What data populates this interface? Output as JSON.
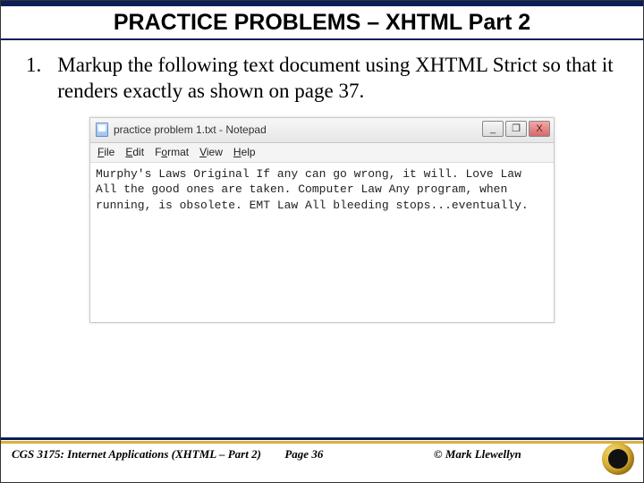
{
  "title": "PRACTICE PROBLEMS – XHTML Part 2",
  "item": {
    "number": "1.",
    "text": "Markup the following text document using XHTML Strict so that it renders exactly as shown on page 37."
  },
  "notepad": {
    "window_title": "practice problem 1.txt - Notepad",
    "menus": {
      "file": "File",
      "edit": "Edit",
      "format": "Format",
      "view": "View",
      "help": "Help"
    },
    "buttons": {
      "min": "_",
      "max": "❐",
      "close": "X"
    },
    "content": "Murphy's Laws Original If any can go wrong, it will. Love Law All the good ones are taken. Computer Law Any program, when running, is obsolete. EMT Law All bleeding stops...eventually."
  },
  "footer": {
    "left": "CGS 3175: Internet Applications (XHTML – Part 2)",
    "mid": "Page 36",
    "right": "© Mark Llewellyn"
  }
}
